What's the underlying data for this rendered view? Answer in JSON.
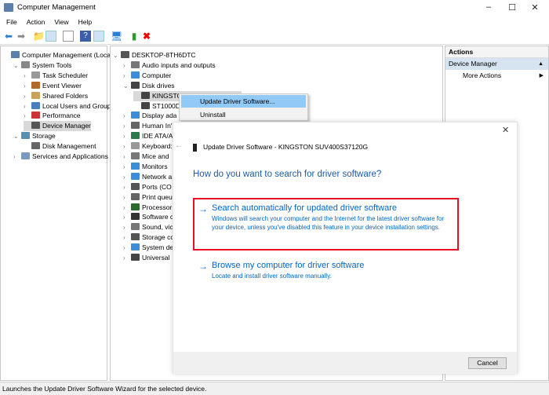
{
  "window": {
    "title": "Computer Management"
  },
  "menu": [
    "File",
    "Action",
    "View",
    "Help"
  ],
  "left_tree": [
    {
      "label": "Computer Management (Local",
      "level": 0,
      "chev": ""
    },
    {
      "label": "System Tools",
      "level": 1,
      "chev": "v"
    },
    {
      "label": "Task Scheduler",
      "level": 2,
      "chev": ">"
    },
    {
      "label": "Event Viewer",
      "level": 2,
      "chev": ">"
    },
    {
      "label": "Shared Folders",
      "level": 2,
      "chev": ">"
    },
    {
      "label": "Local Users and Groups",
      "level": 2,
      "chev": ">"
    },
    {
      "label": "Performance",
      "level": 2,
      "chev": ">"
    },
    {
      "label": "Device Manager",
      "level": 2,
      "chev": "",
      "selected": true
    },
    {
      "label": "Storage",
      "level": 1,
      "chev": "v"
    },
    {
      "label": "Disk Management",
      "level": 2,
      "chev": ""
    },
    {
      "label": "Services and Applications",
      "level": 1,
      "chev": ">"
    }
  ],
  "device_tree": [
    {
      "label": "DESKTOP-8TH6DTC",
      "level": 0,
      "chev": "v"
    },
    {
      "label": "Audio inputs and outputs",
      "level": 1,
      "chev": ">"
    },
    {
      "label": "Computer",
      "level": 1,
      "chev": ">"
    },
    {
      "label": "Disk drives",
      "level": 1,
      "chev": "v"
    },
    {
      "label": "KINGSTON SUV400S37120G",
      "level": 2,
      "chev": "",
      "selected": true
    },
    {
      "label": "ST1000D",
      "level": 2,
      "chev": ""
    },
    {
      "label": "Display ada",
      "level": 1,
      "chev": ">"
    },
    {
      "label": "Human In'",
      "level": 1,
      "chev": ">"
    },
    {
      "label": "IDE ATA/A",
      "level": 1,
      "chev": ">"
    },
    {
      "label": "Keyboard:",
      "level": 1,
      "chev": ">"
    },
    {
      "label": "Mice and",
      "level": 1,
      "chev": ">"
    },
    {
      "label": "Monitors",
      "level": 1,
      "chev": ">"
    },
    {
      "label": "Network a",
      "level": 1,
      "chev": ">"
    },
    {
      "label": "Ports (CO",
      "level": 1,
      "chev": ">"
    },
    {
      "label": "Print queu",
      "level": 1,
      "chev": ">"
    },
    {
      "label": "Processor:",
      "level": 1,
      "chev": ">"
    },
    {
      "label": "Software c",
      "level": 1,
      "chev": ">"
    },
    {
      "label": "Sound, vic",
      "level": 1,
      "chev": ">"
    },
    {
      "label": "Storage cc",
      "level": 1,
      "chev": ">"
    },
    {
      "label": "System de",
      "level": 1,
      "chev": ">"
    },
    {
      "label": "Universal",
      "level": 1,
      "chev": ">"
    }
  ],
  "context_menu": [
    "Update Driver Software...",
    "Uninstall"
  ],
  "actions": {
    "header": "Actions",
    "section": "Device Manager",
    "more": "More Actions"
  },
  "dialog": {
    "title": "Update Driver Software - KINGSTON SUV400S37120G",
    "question": "How do you want to search for driver software?",
    "option1": {
      "title": "Search automatically for updated driver software",
      "desc": "Windows will search your computer and the Internet for the latest driver software for your device, unless you've disabled this feature in your device installation settings."
    },
    "option2": {
      "title": "Browse my computer for driver software",
      "desc": "Locate and install driver software manually."
    },
    "cancel": "Cancel"
  },
  "status": "Launches the Update Driver Software Wizard for the selected device.",
  "colors": {
    "link": "#0066cc",
    "highlight_box": "#e81123",
    "menu_highlight": "#91c9f7"
  }
}
